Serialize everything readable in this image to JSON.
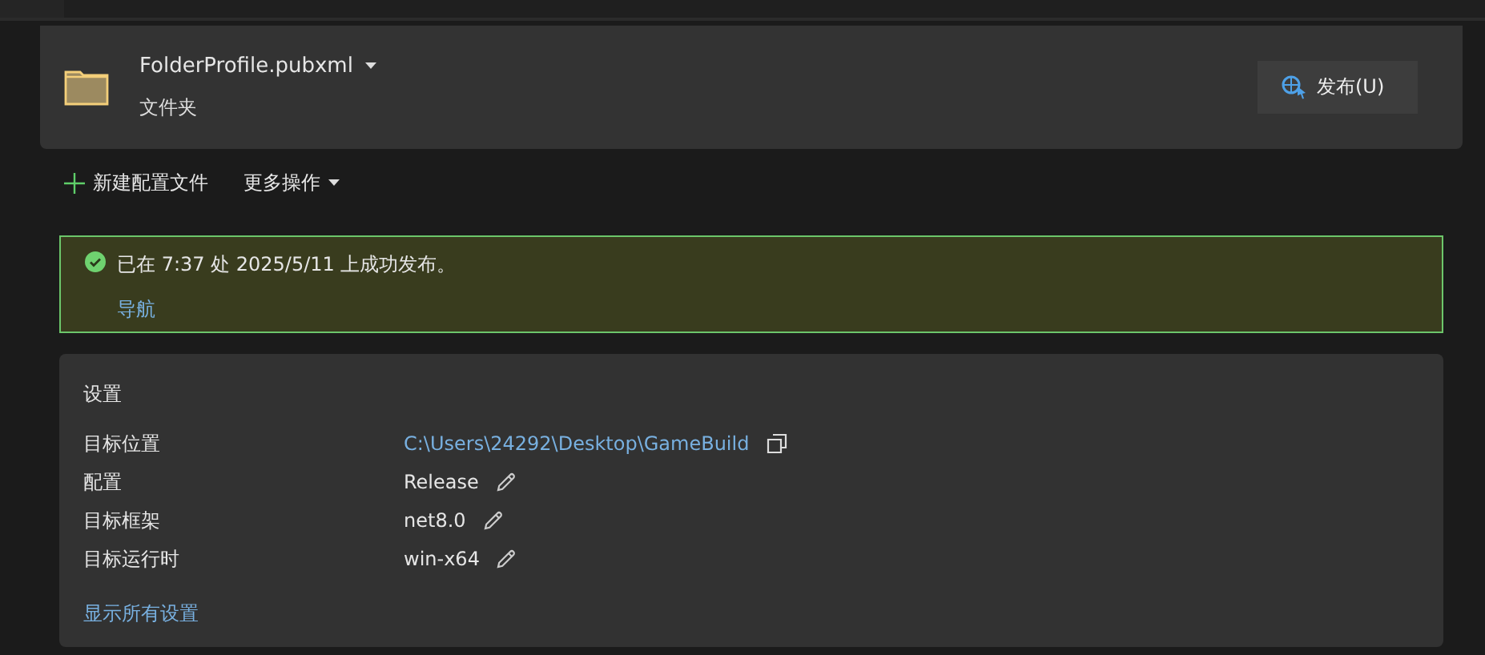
{
  "profile": {
    "name": "FolderProfile.pubxml",
    "type": "文件夹",
    "publish_button": "发布(U)"
  },
  "toolbar": {
    "new_profile": "新建配置文件",
    "more_actions": "更多操作"
  },
  "banner": {
    "message": "已在 7:37 处 2025/5/11 上成功发布。",
    "link": "导航"
  },
  "settings": {
    "title": "设置",
    "rows": [
      {
        "label": "目标位置",
        "value": "C:\\Users\\24292\\Desktop\\GameBuild",
        "kind": "path"
      },
      {
        "label": "配置",
        "value": "Release",
        "kind": "editable"
      },
      {
        "label": "目标框架",
        "value": "net8.0",
        "kind": "editable"
      },
      {
        "label": "目标运行时",
        "value": "win-x64",
        "kind": "editable"
      }
    ],
    "show_all": "显示所有设置"
  }
}
